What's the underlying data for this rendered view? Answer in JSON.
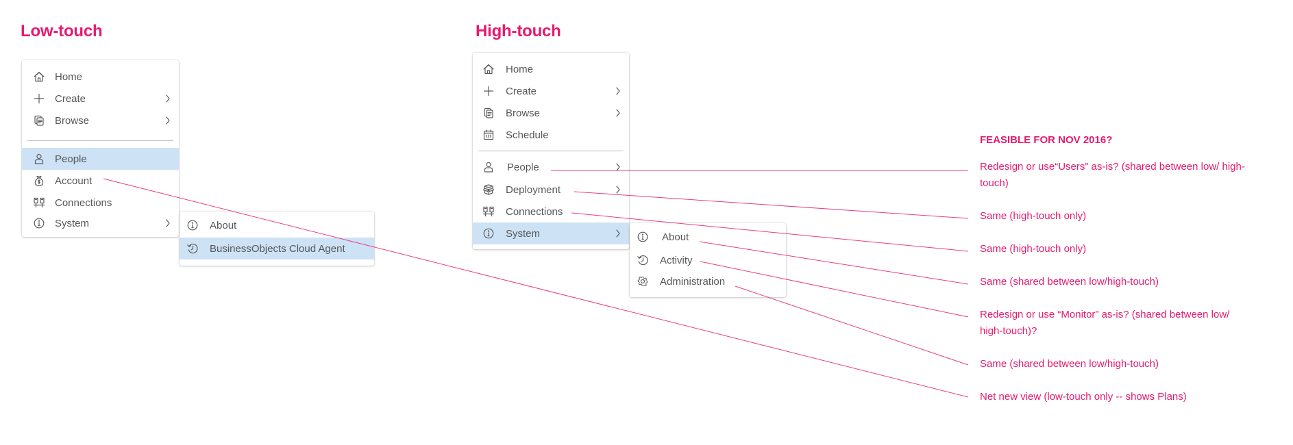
{
  "low_touch": {
    "title": "Low-touch",
    "menu": [
      {
        "label": "Home",
        "icon": "home-icon",
        "submenu": false
      },
      {
        "label": "Create",
        "icon": "plus-icon",
        "submenu": true
      },
      {
        "label": "Browse",
        "icon": "documents-icon",
        "submenu": true
      },
      {
        "label": "People",
        "icon": "person-icon",
        "submenu": false,
        "selected": true
      },
      {
        "label": "Account",
        "icon": "money-bag-icon",
        "submenu": false
      },
      {
        "label": "Connections",
        "icon": "connections-icon",
        "submenu": false
      },
      {
        "label": "System",
        "icon": "info-icon",
        "submenu": true
      }
    ],
    "submenu": [
      {
        "label": "About",
        "icon": "info-icon"
      },
      {
        "label": "BusinessObjects Cloud Agent",
        "icon": "history-icon",
        "selected": true
      }
    ]
  },
  "high_touch": {
    "title": "High-touch",
    "menu": [
      {
        "label": "Home",
        "icon": "home-icon",
        "submenu": false
      },
      {
        "label": "Create",
        "icon": "plus-icon",
        "submenu": true
      },
      {
        "label": "Browse",
        "icon": "documents-icon",
        "submenu": true
      },
      {
        "label": "Schedule",
        "icon": "calendar-icon",
        "submenu": false
      },
      {
        "label": "People",
        "icon": "person-icon",
        "submenu": true
      },
      {
        "label": "Deployment",
        "icon": "package-icon",
        "submenu": true
      },
      {
        "label": "Connections",
        "icon": "connections-icon",
        "submenu": false
      },
      {
        "label": "System",
        "icon": "info-icon",
        "submenu": true,
        "selected": true
      }
    ],
    "submenu": [
      {
        "label": "About",
        "icon": "info-icon"
      },
      {
        "label": "Activity",
        "icon": "history-icon"
      },
      {
        "label": "Administration",
        "icon": "gear-icon"
      }
    ]
  },
  "notes": {
    "heading": "FEASIBLE FOR NOV 2016?",
    "items": [
      "Redesign or  use“Users” as-is? (shared between low/ high-touch)",
      "Same (high-touch only)",
      "Same (high-touch only)",
      "Same (shared between low/high-touch)",
      "Redesign or use “Monitor” as-is? (shared between low/ high-touch)?",
      "Same (shared between low/high-touch)",
      "Net new view (low-touch only -- shows Plans)"
    ]
  },
  "colors": {
    "accent": "#e8196e",
    "selected_bg": "#cde2f5",
    "text": "#55565a",
    "icon": "#5a5b5f"
  }
}
